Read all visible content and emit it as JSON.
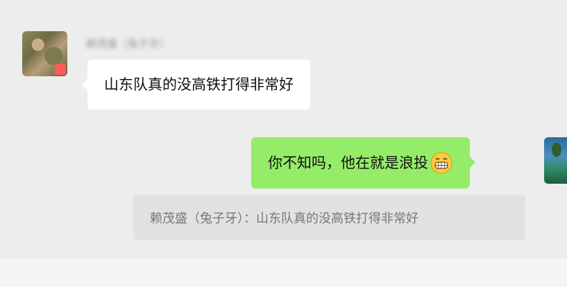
{
  "chat": {
    "sender_name": "赖茂盛（兔子牙）",
    "incoming_message": "山东队真的没高铁打得非常好",
    "outgoing_message": "你不知吗，他在就是浪投",
    "outgoing_emoji": "grin-icon",
    "quote": {
      "text": "赖茂盛（兔子牙）：山东队真的没高铁打得非常好"
    }
  },
  "colors": {
    "background": "#ededed",
    "incoming_bubble": "#ffffff",
    "outgoing_bubble": "#95ec69",
    "quote_box": "#e2e2e2"
  }
}
